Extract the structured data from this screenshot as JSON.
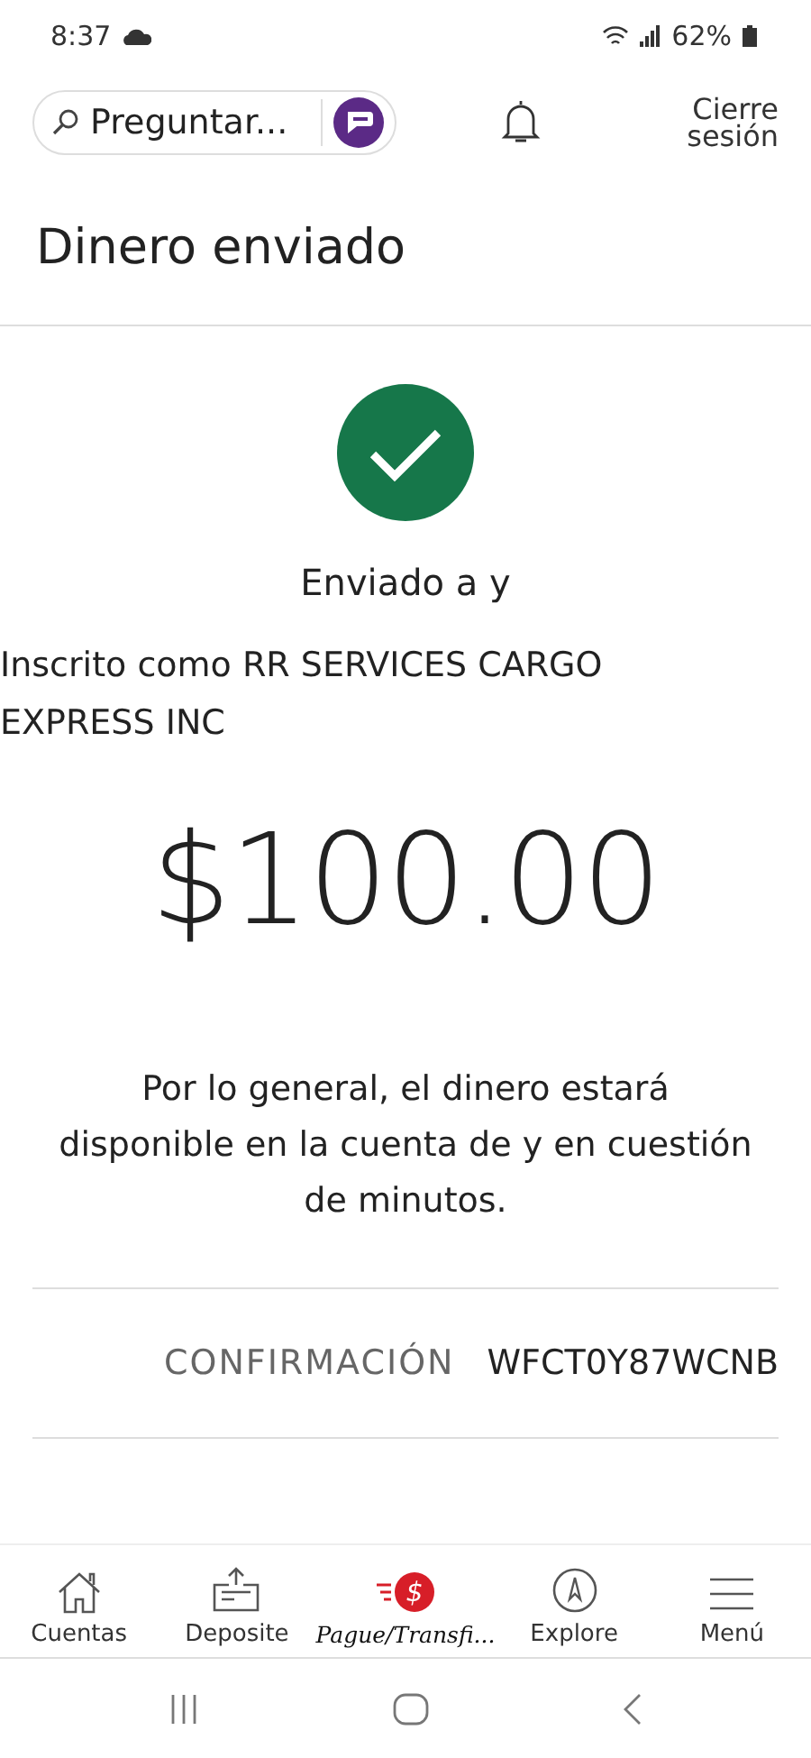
{
  "status_bar": {
    "time": "8:37",
    "battery": "62%"
  },
  "header": {
    "search_placeholder": "Preguntar...",
    "sign_out": "Cierre sesión"
  },
  "page": {
    "title": "Dinero enviado"
  },
  "confirmation": {
    "heading": "Enviado a y",
    "recipient": "Inscrito como RR SERVICES CARGO EXPRESS INC",
    "amount": "$100.00",
    "note": "Por lo general, el dinero estará disponible en la cuenta de y en cuestión de minutos.",
    "label": "CONFIRMACIÓN",
    "code": "WFCT0Y87WCNB"
  },
  "tab_bar": [
    {
      "label": "Cuentas",
      "selected": false
    },
    {
      "label": "Deposite",
      "selected": false
    },
    {
      "label": "Pague/Transfi...",
      "selected": true,
      "icon_text": "$"
    },
    {
      "label": "Explore",
      "selected": false
    },
    {
      "label": "Menú",
      "selected": false
    }
  ]
}
